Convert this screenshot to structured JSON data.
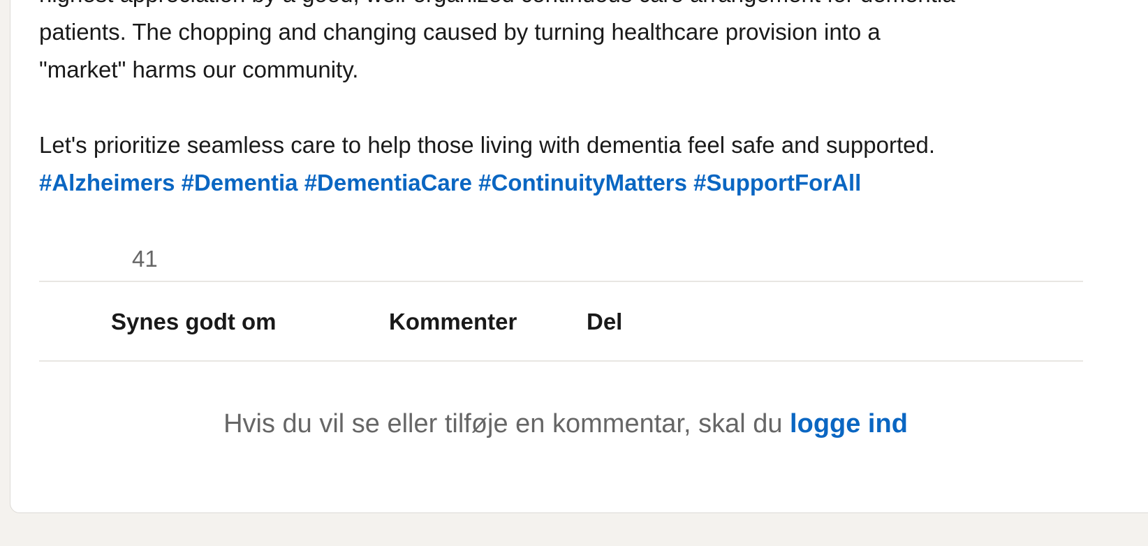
{
  "post": {
    "clipped_line": "highest appreciation by a good, well-organized continuous care arrangement for dementia",
    "lines": [
      "patients. The chopping and changing caused by turning healthcare provision into a",
      "\"market\" harms our community.",
      "Let's prioritize seamless care to help those living with dementia feel safe and supported."
    ],
    "hashtags": [
      "#Alzheimers",
      "#Dementia",
      "#DementiaCare",
      "#ContinuityMatters",
      "#SupportForAll"
    ]
  },
  "social": {
    "reaction_count": "41"
  },
  "actions": {
    "like_label": "Synes godt om",
    "comment_label": "Kommenter",
    "share_label": "Del"
  },
  "comments": {
    "prompt": "Hvis du vil se eller tilføje en kommentar, skal du",
    "login_label": "logge ind"
  },
  "colors": {
    "link": "#0a66c2",
    "muted": "#666666",
    "divider": "#e8e6e2"
  }
}
